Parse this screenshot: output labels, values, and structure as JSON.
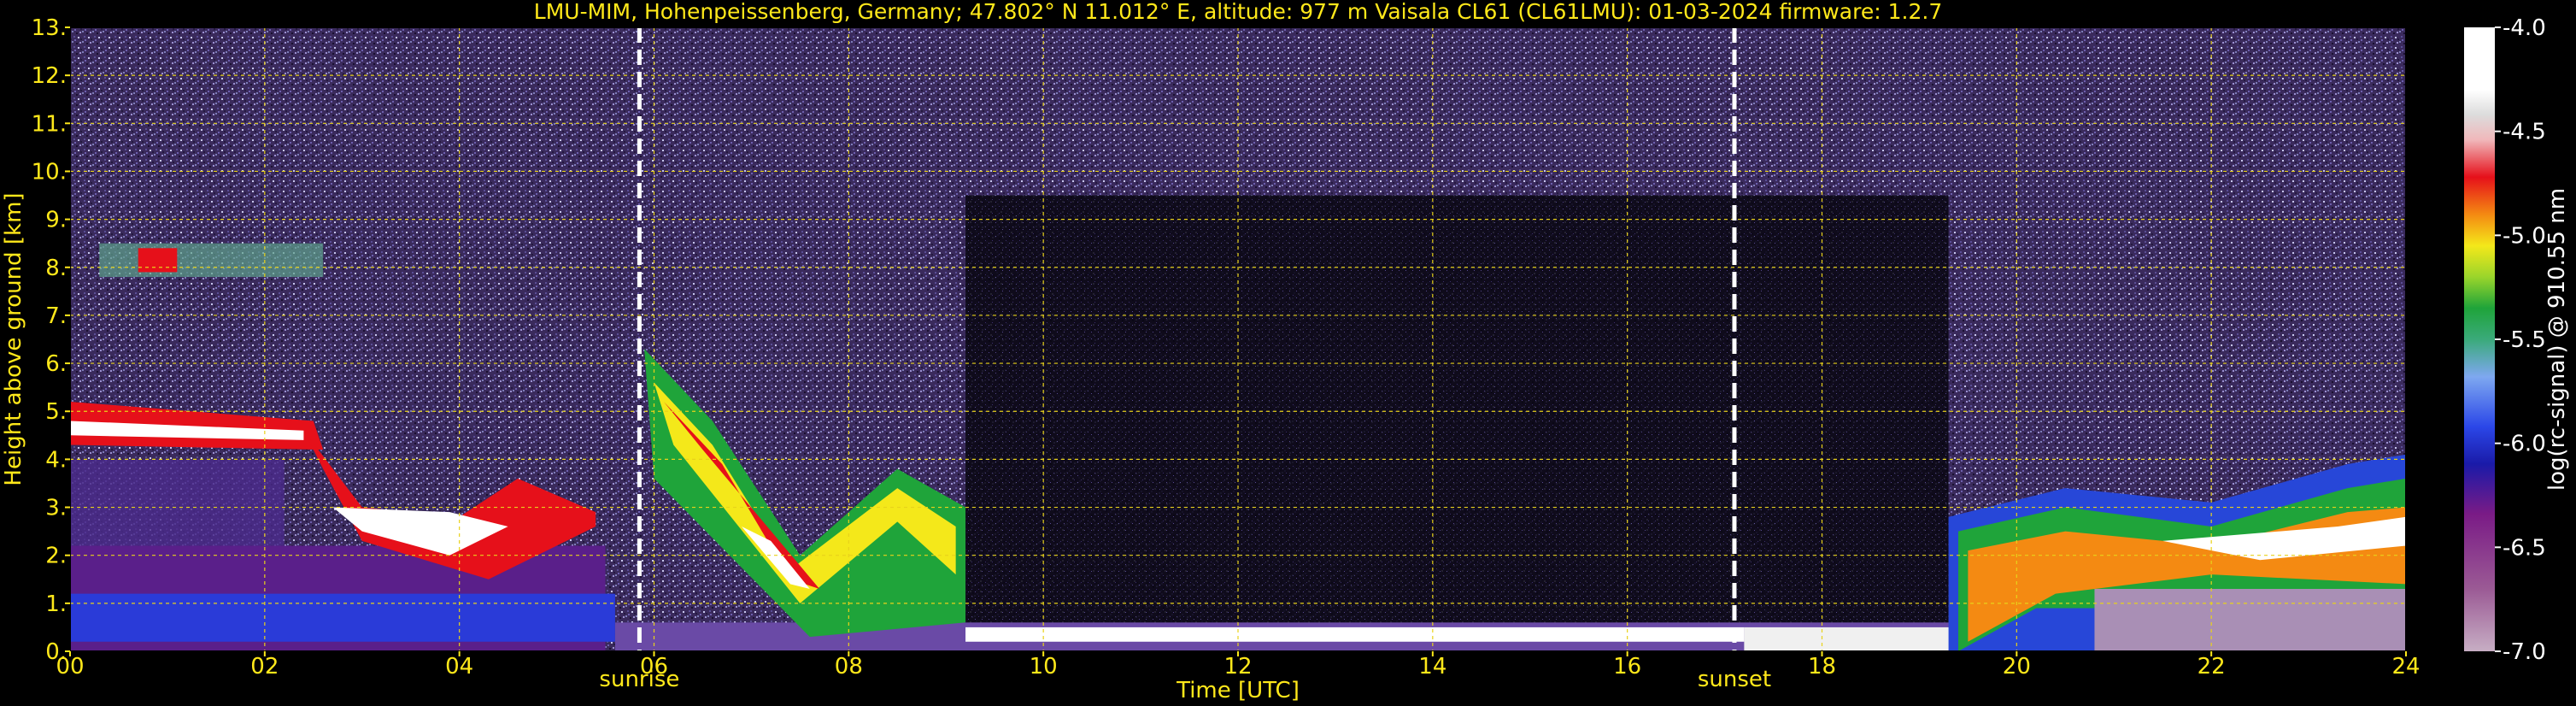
{
  "chart_data": {
    "type": "heatmap",
    "title": "LMU-MIM, Hohenpeissenberg, Germany; 47.802° N 11.012° E, altitude: 977 m    Vaisala CL61 (CL61LMU): 01-03-2024    firmware: 1.2.7",
    "xlabel": "Time [UTC]",
    "ylabel": "Height above ground [km]",
    "x_range": [
      0,
      24
    ],
    "y_range": [
      0,
      13
    ],
    "x_ticks": [
      "00",
      "02",
      "04",
      "06",
      "08",
      "10",
      "12",
      "14",
      "16",
      "18",
      "20",
      "22",
      "24"
    ],
    "y_ticks": [
      "0.",
      "1.",
      "2.",
      "3.",
      "4.",
      "5.",
      "6.",
      "7.",
      "8.",
      "9.",
      "10.",
      "11.",
      "12.",
      "13."
    ],
    "grid": true,
    "annotations": [
      {
        "label": "sunrise",
        "x": 5.85
      },
      {
        "label": "sunset",
        "x": 17.1
      }
    ],
    "colorbar": {
      "label": "log(rc-signal) @ 910.55 nm",
      "range": [
        -7.0,
        -4.0
      ],
      "ticks": [
        "-4.0",
        "-4.5",
        "-5.0",
        "-5.5",
        "-6.0",
        "-6.5",
        "-7.0"
      ]
    },
    "features": [
      {
        "name": "high aerosol/cloud layer",
        "start": 0.0,
        "end": 2.6,
        "height_km": 8.1
      },
      {
        "name": "mid-level layer",
        "start": 0.0,
        "end": 2.0,
        "height_km": 4.6
      },
      {
        "name": "descending layer",
        "start": 2.0,
        "end": 5.5,
        "height_km": 2.8
      },
      {
        "name": "post-sunrise descending layer",
        "start": 6.0,
        "end": 9.2,
        "height_km": 3.0
      },
      {
        "name": "evening cloud layer",
        "start": 19.3,
        "end": 24.0,
        "height_km": 2.8
      }
    ]
  }
}
